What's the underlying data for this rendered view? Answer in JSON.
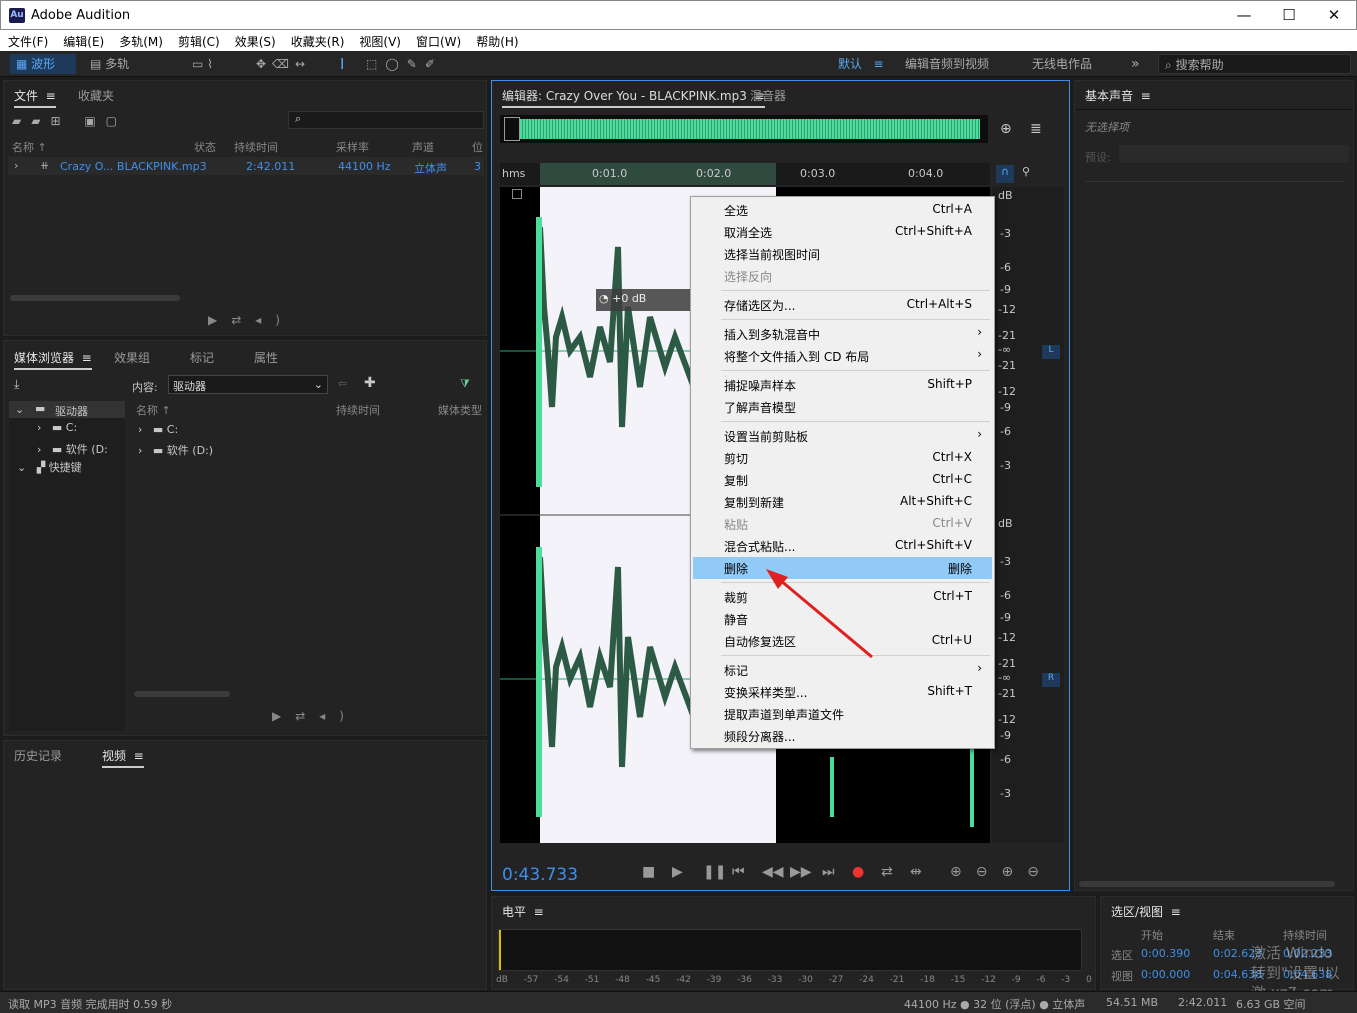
{
  "app": {
    "logo": "Au",
    "title": "Adobe Audition",
    "min": "—",
    "max": "☐",
    "close": "✕"
  },
  "menu": [
    "文件(F)",
    "编辑(E)",
    "多轨(M)",
    "剪辑(C)",
    "效果(S)",
    "收藏夹(R)",
    "视图(V)",
    "窗口(W)",
    "帮助(H)"
  ],
  "toolbar": {
    "waveform": "波形",
    "multitrack": "多轨",
    "workspace": "默认",
    "ws2": "编辑音频到视频",
    "ws3": "无线电作品",
    "more": "»",
    "search_placeholder": "搜索帮助"
  },
  "files": {
    "tab1": "文件",
    "tab2": "收藏夹",
    "cols": [
      "名称",
      "状态",
      "持续时间",
      "采样率",
      "声道",
      "位"
    ],
    "row": {
      "name": "Crazy O... BLACKPINK.mp3",
      "duration": "2:42.011",
      "rate": "44100 Hz",
      "channels": "立体声",
      "bits": "3"
    }
  },
  "media": {
    "tabs": [
      "媒体浏览器",
      "效果组",
      "标记",
      "属性"
    ],
    "content_label": "内容:",
    "content_value": "驱动器",
    "tree": [
      {
        "label": "驱动器"
      },
      {
        "label": "C:"
      },
      {
        "label": "软件 (D:"
      },
      {
        "label": "快捷键"
      }
    ],
    "cols": [
      "名称",
      "持续时间",
      "媒体类型"
    ],
    "rows": [
      "C:",
      "软件 (D:)"
    ]
  },
  "history": {
    "tab1": "历史记录",
    "tab2": "视频"
  },
  "editor": {
    "tab": "编辑器: Crazy Over You - BLACKPINK.mp3",
    "tab2": "混音器",
    "ruler": [
      "hms",
      "0:01.0",
      "0:02.0",
      "0:03.0",
      "0:04.0"
    ],
    "db_top": [
      "dB",
      "-3",
      "-6",
      "-9",
      "-12",
      "-21",
      "-∞",
      "-21",
      "-12",
      "-9",
      "-6",
      "-3"
    ],
    "db_bot": [
      "dB",
      "-3",
      "-6",
      "-9",
      "-12",
      "-21",
      "-∞",
      "-21",
      "-12",
      "-9",
      "-6",
      "-3"
    ],
    "ch_l": "L",
    "ch_r": "R",
    "hud": "+0 dB",
    "time": "0:43.733"
  },
  "context_menu": [
    {
      "label": "全选",
      "shortcut": "Ctrl+A"
    },
    {
      "label": "取消全选",
      "shortcut": "Ctrl+Shift+A"
    },
    {
      "label": "选择当前视图时间",
      "shortcut": ""
    },
    {
      "label": "选择反向",
      "shortcut": "",
      "disabled": true
    },
    {
      "label": "存储选区为...",
      "shortcut": "Ctrl+Alt+S"
    },
    {
      "label": "插入到多轨混音中",
      "shortcut": "",
      "submenu": true
    },
    {
      "label": "将整个文件插入到 CD 布局",
      "shortcut": "",
      "submenu": true
    },
    {
      "label": "捕捉噪声样本",
      "shortcut": "Shift+P"
    },
    {
      "label": "了解声音模型",
      "shortcut": ""
    },
    {
      "label": "设置当前剪贴板",
      "shortcut": "",
      "submenu": true
    },
    {
      "label": "剪切",
      "shortcut": "Ctrl+X"
    },
    {
      "label": "复制",
      "shortcut": "Ctrl+C"
    },
    {
      "label": "复制到新建",
      "shortcut": "Alt+Shift+C"
    },
    {
      "label": "粘贴",
      "shortcut": "Ctrl+V",
      "disabled": true
    },
    {
      "label": "混合式粘贴...",
      "shortcut": "Ctrl+Shift+V"
    },
    {
      "label": "删除",
      "shortcut": "删除",
      "highlighted": true
    },
    {
      "label": "裁剪",
      "shortcut": "Ctrl+T"
    },
    {
      "label": "静音",
      "shortcut": ""
    },
    {
      "label": "自动修复选区",
      "shortcut": "Ctrl+U"
    },
    {
      "label": "标记",
      "shortcut": "",
      "submenu": true
    },
    {
      "label": "变换采样类型...",
      "shortcut": "Shift+T"
    },
    {
      "label": "提取声道到单声道文件",
      "shortcut": ""
    },
    {
      "label": "频段分离器...",
      "shortcut": ""
    }
  ],
  "essential": {
    "title": "基本声音",
    "noselect": "无选择项",
    "preset": "预设:"
  },
  "level": {
    "title": "电平",
    "scale": [
      "dB",
      "-57",
      "-54",
      "-51",
      "-48",
      "-45",
      "-42",
      "-39",
      "-36",
      "-33",
      "-30",
      "-27",
      "-24",
      "-21",
      "-18",
      "-15",
      "-12",
      "-9",
      "-6",
      "-3",
      "0"
    ]
  },
  "selview": {
    "title": "选区/视图",
    "cols": [
      "开始",
      "结束",
      "持续时间"
    ],
    "sel_label": "选区",
    "sel": [
      "0:00.390",
      "0:02.623",
      "0:02.233"
    ],
    "view_label": "视图",
    "view": [
      "0:00.000",
      "0:04.638",
      "0:04.638"
    ]
  },
  "status": {
    "left": "读取 MP3 音频 完成用时 0.59 秒",
    "fmt": "44100 Hz ● 32 位 (浮点) ● 立体声",
    "size": "54.51 MB",
    "dur": "2:42.011",
    "free": "6.63 GB 空间"
  },
  "watermark": "激活 Windo 转到\"设置\"以激 xz7.com",
  "colors": {
    "accent": "#3f8fe8",
    "wave": "#4ddc9c",
    "select_bg": "#f3f3f9"
  }
}
